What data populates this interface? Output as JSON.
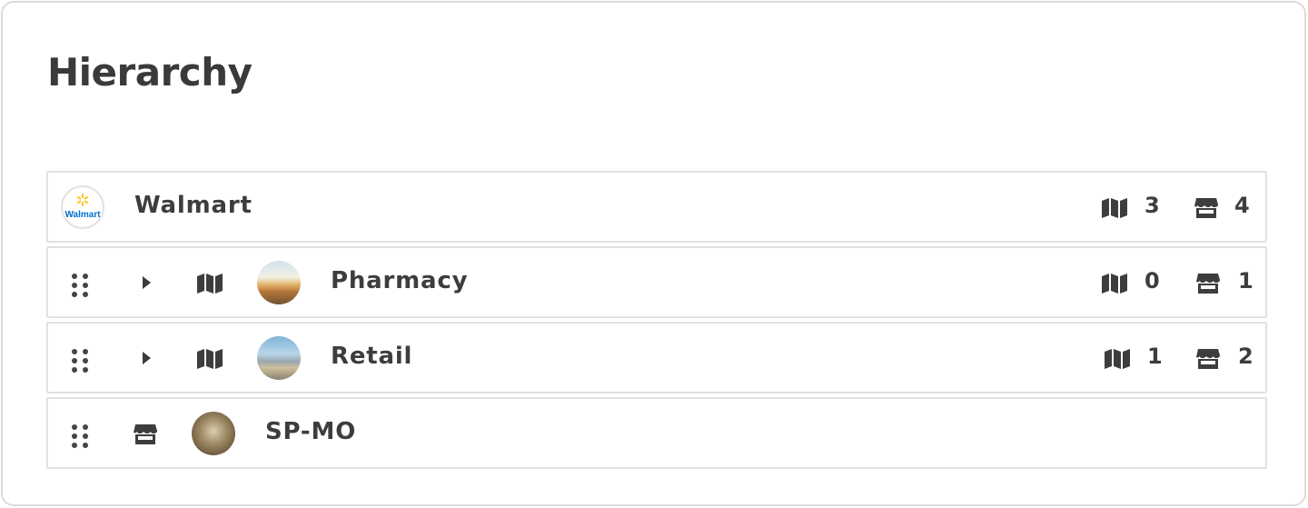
{
  "page": {
    "title": "Hierarchy"
  },
  "rows": [
    {
      "name": "Walmart",
      "maps": "3",
      "stores": "4",
      "logo_text": "Walmart"
    },
    {
      "name": "Pharmacy",
      "maps": "0",
      "stores": "1"
    },
    {
      "name": "Retail",
      "maps": "1",
      "stores": "2"
    },
    {
      "name": "SP-MO"
    }
  ],
  "colors": {
    "walmart_blue": "#0071ce",
    "walmart_yellow": "#ffc220",
    "text": "#3d3d3d",
    "border": "#e1e1e1"
  },
  "icons": [
    "drag-handle-icon",
    "caret-right-icon",
    "map-icon",
    "store-icon"
  ]
}
